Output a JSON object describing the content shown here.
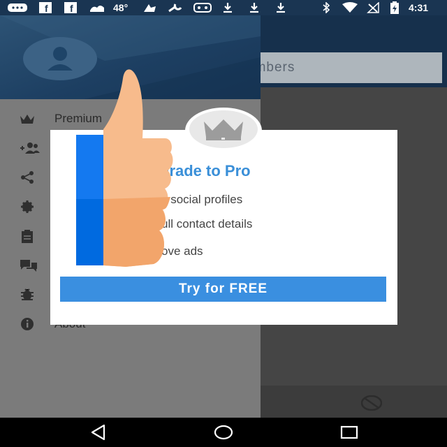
{
  "status_bar": {
    "temperature": "48°",
    "time": "4:31",
    "icons": [
      "chat-icon",
      "facebook-icon",
      "facebook-icon",
      "weather-icon",
      "app-icon",
      "wrench-icon",
      "gamepad-icon",
      "download-icon",
      "download-icon",
      "download-icon",
      "bluetooth-icon",
      "wifi-icon",
      "no-signal-icon",
      "battery-icon"
    ]
  },
  "app": {
    "search_placeholder_partial": "umbers"
  },
  "drawer": {
    "items": [
      {
        "label": "Premium",
        "icon": "crown-icon"
      },
      {
        "label": "",
        "icon": "add-friend-icon"
      },
      {
        "label": "",
        "icon": "share-icon"
      },
      {
        "label": "",
        "icon": "settings-icon"
      },
      {
        "label": "",
        "icon": "clipboard-icon"
      },
      {
        "label": "",
        "icon": "chat-icon"
      },
      {
        "label": "",
        "icon": "bug-icon"
      },
      {
        "label": "About",
        "icon": "info-icon"
      }
    ]
  },
  "dialog": {
    "title_partial": "grade to Pro",
    "features": [
      "k social profiles",
      "ull contact details",
      "ove ads"
    ],
    "cta_label": "Try for FREE",
    "icon": "crown-icon"
  },
  "nav_bar": {
    "icons": [
      "back-icon",
      "home-icon",
      "recents-icon"
    ]
  },
  "colors": {
    "accent": "#3a8fe0",
    "drawer_header": "#1d3f62",
    "thumb": "#f5ae75"
  }
}
